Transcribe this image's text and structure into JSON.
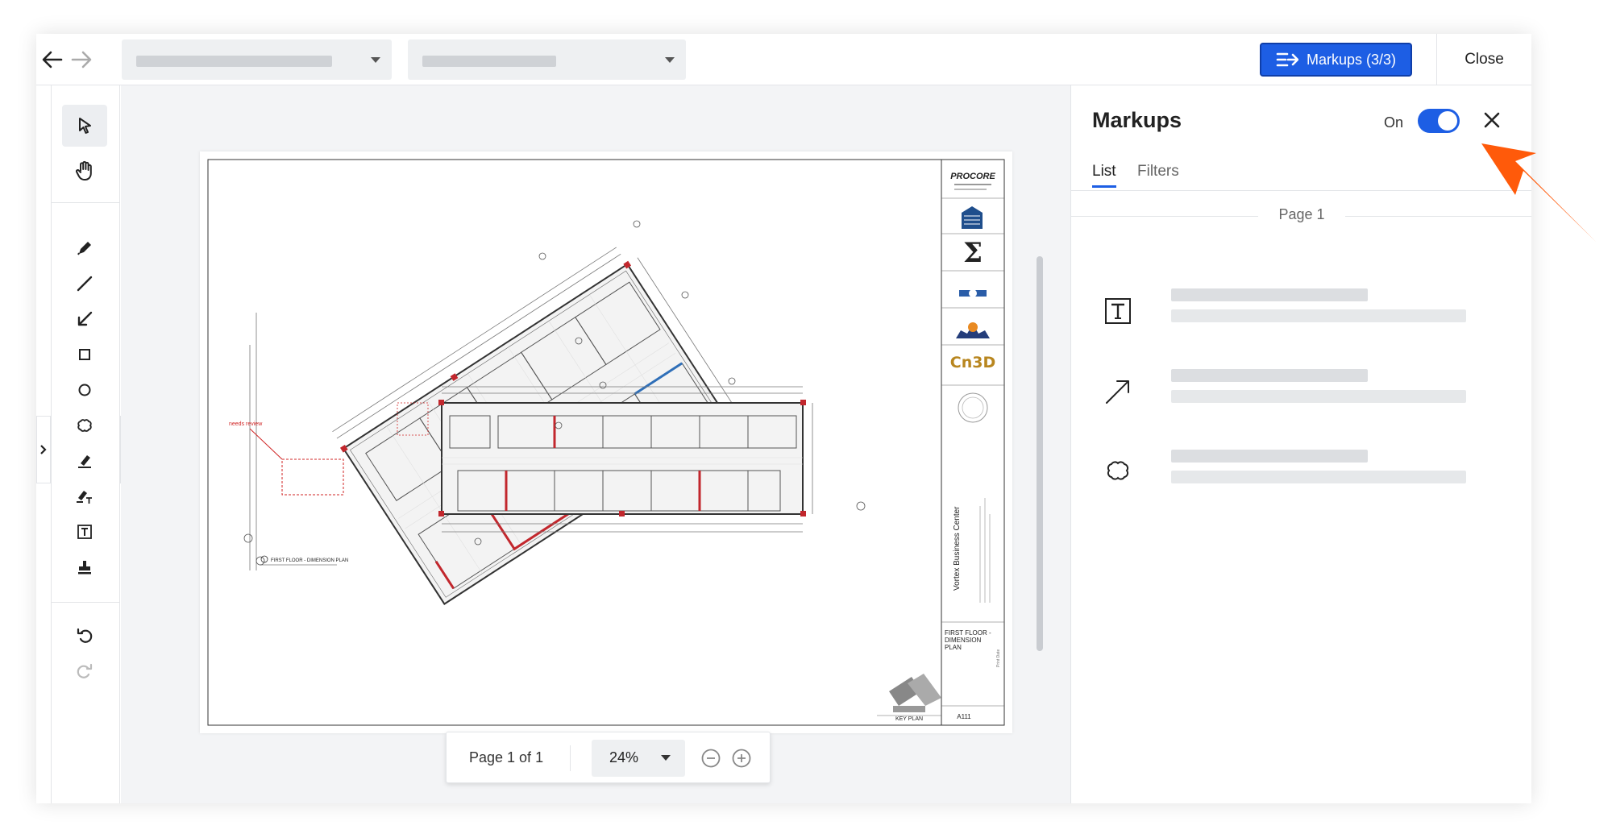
{
  "topbar": {
    "markups_button_label": "Markups (3/3)",
    "close_label": "Close"
  },
  "toolbar": {
    "tools": [
      "select-tool",
      "pan-tool",
      "pen-tool",
      "line-tool",
      "arrow-tool",
      "rectangle-tool",
      "ellipse-tool",
      "cloud-tool",
      "highlighter-tool",
      "text-highlight-tool",
      "text-tool",
      "stamp-tool",
      "undo",
      "redo"
    ]
  },
  "pager": {
    "page_label": "Page 1 of 1",
    "zoom": "24%"
  },
  "sheet": {
    "brand": "PROCORE",
    "annotation": "needs review",
    "drawing_title": "FIRST FLOOR - DIMENSION PLAN",
    "project_name": "Vortex Business Center",
    "sheet_title": "FIRST FLOOR - DIMENSION PLAN",
    "sheet_number": "A111",
    "key_plan_label": "KEY PLAN",
    "logo_cn3d": "Cn3D"
  },
  "panel": {
    "title": "Markups",
    "toggle_label": "On",
    "toggle_on": true,
    "tabs": [
      "List",
      "Filters"
    ],
    "page_group": "Page 1",
    "items": [
      {
        "icon": "text-icon"
      },
      {
        "icon": "arrow-icon"
      },
      {
        "icon": "cloud-icon"
      }
    ]
  },
  "colors": {
    "accent": "#1d5ee4",
    "callout": "#ff5a0a"
  }
}
